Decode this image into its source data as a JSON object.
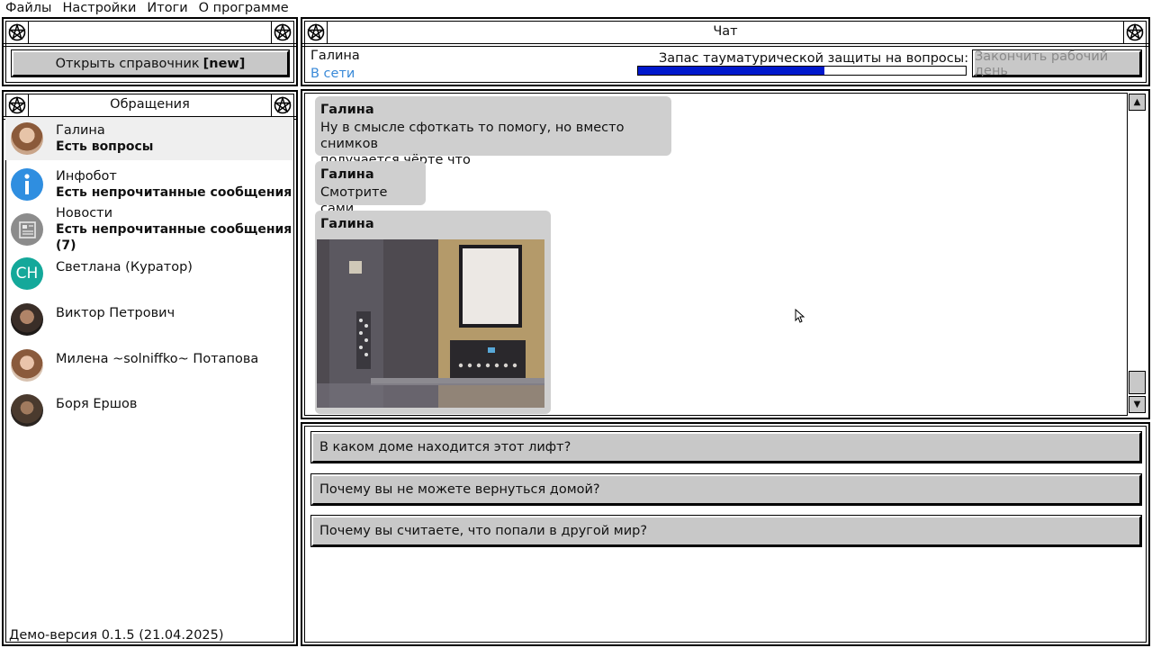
{
  "menu": [
    "Файлы",
    "Настройки",
    "Итоги",
    "О программе"
  ],
  "left_top": {
    "open_button_label": "Открыть справочник",
    "open_button_tag": "[new]"
  },
  "contacts_panel": {
    "title": "Обращения",
    "items": [
      {
        "name": "Галина",
        "status": "Есть вопросы",
        "avatar": "photo",
        "active": true
      },
      {
        "name": "Инфобот",
        "status": "Есть непрочитанные сообщения",
        "avatar": "info-icon"
      },
      {
        "name": "Новости",
        "status": "Есть непрочитанные сообщения (7)",
        "avatar": "newspaper-icon"
      },
      {
        "name": "Светлана (Куратор)",
        "status": "",
        "avatar_text": "СН",
        "avatar_color": "#14a89a"
      },
      {
        "name": "Виктор Петрович",
        "status": "",
        "avatar": "photo"
      },
      {
        "name": "Милена ~solniffko~ Потапова",
        "status": "",
        "avatar": "photo"
      },
      {
        "name": "Боря Ершов",
        "status": "",
        "avatar": "photo"
      }
    ]
  },
  "version": "Демо-версия 0.1.5 (21.04.2025)",
  "chat": {
    "title": "Чат",
    "contact_name": "Галина",
    "contact_status": "В сети",
    "protection_label": "Запас тауматурической защиты на вопросы:",
    "protection_level": 0.57,
    "end_day_label": "Закончить рабочий день",
    "messages": [
      {
        "author": "Галина",
        "text1": "Ну в смысле сфоткать то помогу, но вместо снимков",
        "text2": "получается чёрте что"
      },
      {
        "author": "Галина",
        "text1": "Смотрите сами"
      },
      {
        "author": "Галина",
        "image": "elevator-photo"
      }
    ]
  },
  "answers": [
    "В каком доме находится этот лифт?",
    "Почему вы не можете вернуться домой?",
    "Почему вы считаете, что попали в другой мир?"
  ],
  "colors": {
    "accent": "#0018cc",
    "online": "#3a8ad8",
    "button": "#c8c8c8",
    "bubble": "#cfcfcf"
  }
}
